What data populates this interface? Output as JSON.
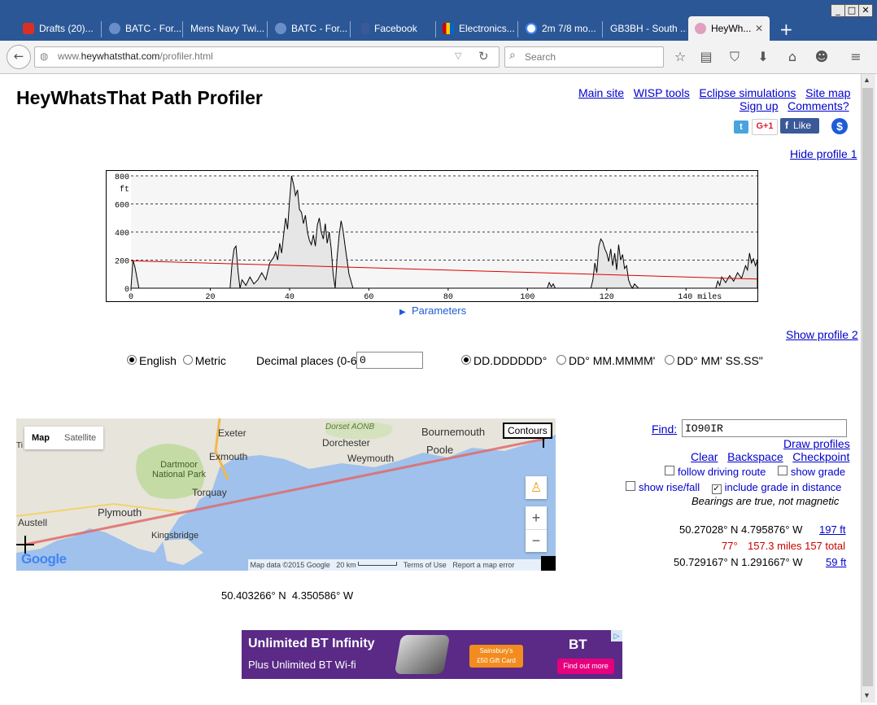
{
  "browser": {
    "tabs": [
      {
        "label": "Drafts (20)...",
        "icon_color": "#d93025"
      },
      {
        "label": "BATC - For...",
        "icon_color": "#6a8fc7"
      },
      {
        "label": "Mens Navy Twi...",
        "icon_color": ""
      },
      {
        "label": "BATC - For...",
        "icon_color": "#6a8fc7"
      },
      {
        "label": "Facebook",
        "icon_color": "#3b5998"
      },
      {
        "label": "Electronics...",
        "icon_color": "#c8a02a"
      },
      {
        "label": "2m 7/8 mo...",
        "icon_color": "#4285f4"
      },
      {
        "label": "GB3BH - South ...",
        "icon_color": ""
      },
      {
        "label": "HeyWh...",
        "icon_color": "#e0a0c0"
      }
    ],
    "url_prefix": "www.",
    "url_domain": "heywhatsthat.com",
    "url_path": "/profiler.html",
    "search_placeholder": "Search",
    "minimize": "_",
    "maximize": "□",
    "close": "✕",
    "new_tab": "+"
  },
  "page": {
    "title": "HeyWhatsThat Path Profiler",
    "top_links": [
      "Main site",
      "WISP tools",
      "Eclipse simulations",
      "Site map"
    ],
    "top_links_2": [
      "Sign up",
      "Comments?"
    ],
    "social": {
      "google_plus": "G+1",
      "like": "Like",
      "dollar": "$"
    },
    "hide_profile": "Hide profile 1",
    "show_profile": "Show profile 2",
    "parameters": "Parameters",
    "units": {
      "english": "English",
      "metric": "Metric",
      "selected": "English"
    },
    "decimal_label": "Decimal places (0-6)",
    "decimal_value": "0",
    "coord_formats": [
      "DD.DDDDDD°",
      "DD° MM.MMMM'",
      "DD° MM' SS.SS\""
    ],
    "coord_format_selected": "DD.DDDDDD°",
    "find_label": "Find:",
    "find_value": "IO90IR",
    "draw_profiles": "Draw profiles",
    "clear": "Clear",
    "backspace": "Backspace",
    "checkpoint": "Checkpoint",
    "opt_follow_route": "follow driving route",
    "opt_show_grade": "show grade",
    "opt_show_rise": "show rise/fall",
    "opt_include_grade": "include grade in distance",
    "opt_include_grade_checked": true,
    "bearings_note": "Bearings are true, not magnetic",
    "point1": {
      "coords": "50.27028° N 4.795876° W",
      "height": "197 ft"
    },
    "bearing": "77°",
    "distance": "157.3 miles 157 total",
    "point2": {
      "coords": "50.729167° N 1.291667° W",
      "height": "59 ft"
    },
    "cursor_coords": "50.403266° N  4.350586° W",
    "map": {
      "btn_map": "Map",
      "btn_satellite": "Satellite",
      "btn_contours": "Contours",
      "places": [
        "Exeter",
        "Exmouth",
        "Dorset AONB",
        "Dorchester",
        "Bournemouth",
        "Poole",
        "Weymouth",
        "Dartmoor National Park",
        "Torquay",
        "Plymouth",
        "Kingsbridge",
        "Austell",
        "Ti"
      ],
      "zoom_in": "+",
      "zoom_out": "−",
      "logo": "Google",
      "footer_data": "Map data ©2015 Google",
      "footer_scale": "20 km",
      "footer_terms": "Terms of Use",
      "footer_report": "Report a map error"
    },
    "ad": {
      "headline": "Unlimited BT Infinity",
      "sub": "Plus Unlimited BT Wi-fi",
      "voucher_1": "Sainsbury's",
      "voucher_2": "£50 Gift Card",
      "brand": "BT",
      "cta": "Find out more"
    }
  },
  "chart_data": {
    "type": "area",
    "x_unit": "miles",
    "y_unit": "ft",
    "xlim": [
      0,
      158
    ],
    "ylim": [
      0,
      800
    ],
    "x_ticks": [
      0,
      20,
      40,
      60,
      80,
      100,
      120,
      140
    ],
    "x_tick_labels": [
      "0",
      "20",
      "40",
      "60",
      "80",
      "100",
      "120",
      "140 miles"
    ],
    "y_ticks": [
      0,
      200,
      400,
      600,
      800
    ],
    "y_label": "ft",
    "grid": "dashed horizontal",
    "terrain": {
      "x": [
        0,
        0.5,
        1,
        2,
        25,
        25.5,
        26,
        26.5,
        27,
        27.5,
        28,
        29,
        30,
        31,
        32,
        33,
        34,
        35,
        36,
        36.5,
        37,
        37.5,
        38,
        38.5,
        39,
        39.5,
        40,
        40.5,
        41,
        41.5,
        42,
        42.5,
        43,
        43.5,
        44,
        44.5,
        45,
        45.5,
        46,
        46.5,
        47,
        47.5,
        48,
        48.5,
        49,
        49.5,
        50,
        50.5,
        51,
        51.5,
        52,
        52.5,
        53,
        53.5,
        54,
        54.5,
        55,
        56,
        105,
        105.5,
        106,
        106.5,
        107,
        116,
        116.5,
        117,
        117.5,
        118,
        118.5,
        119,
        119.5,
        120,
        120.5,
        121,
        121.5,
        122,
        122.5,
        123,
        123.5,
        124,
        124.5,
        125,
        125.5,
        126,
        126.5,
        127,
        128,
        147,
        147.5,
        148,
        148.5,
        149,
        150,
        151,
        152,
        153,
        154,
        155,
        155.5,
        156,
        156.5,
        157,
        157.5,
        158
      ],
      "y": [
        0,
        200,
        150,
        0,
        0,
        180,
        280,
        300,
        120,
        0,
        60,
        20,
        80,
        30,
        60,
        110,
        60,
        180,
        220,
        260,
        200,
        320,
        250,
        380,
        500,
        420,
        620,
        800,
        740,
        660,
        700,
        560,
        540,
        460,
        520,
        400,
        340,
        310,
        380,
        300,
        450,
        500,
        400,
        350,
        460,
        320,
        400,
        280,
        100,
        0,
        220,
        380,
        480,
        410,
        300,
        200,
        100,
        0,
        0,
        40,
        10,
        30,
        0,
        0,
        60,
        180,
        110,
        300,
        350,
        330,
        280,
        250,
        190,
        280,
        160,
        250,
        130,
        310,
        200,
        240,
        140,
        160,
        60,
        20,
        0,
        30,
        0,
        0,
        0,
        50,
        20,
        80,
        40,
        90,
        50,
        110,
        70,
        160,
        130,
        250,
        180,
        210,
        160,
        200,
        120
      ]
    },
    "sightline_y": [
      195,
      65
    ]
  }
}
